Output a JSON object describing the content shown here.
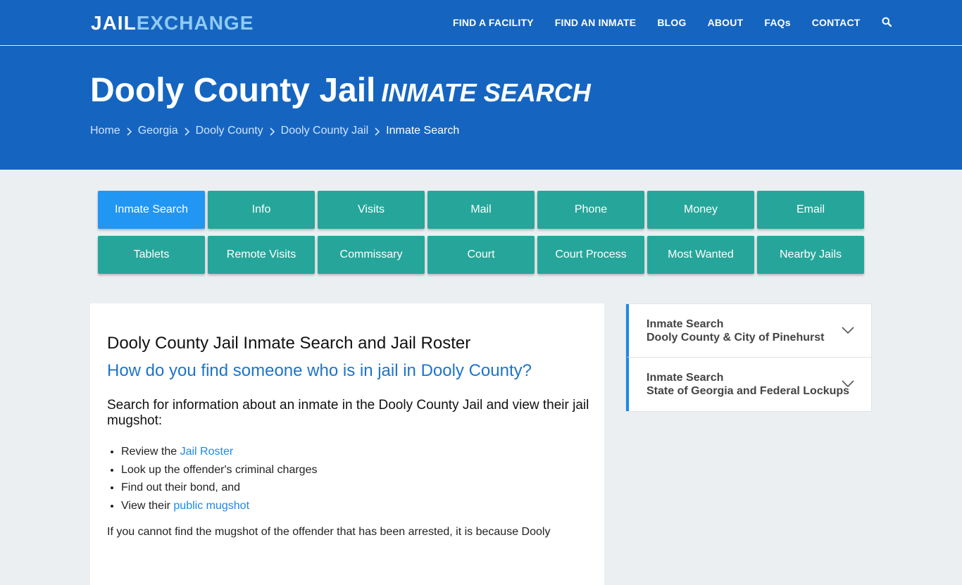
{
  "header": {
    "logo_part1": "JAIL",
    "logo_part2": "EXCHANGE",
    "nav": [
      "FIND A FACILITY",
      "FIND AN INMATE",
      "BLOG",
      "ABOUT",
      "FAQs",
      "CONTACT"
    ],
    "search_icon": "search-icon"
  },
  "hero": {
    "title": "Dooly County Jail",
    "subtitle": "Inmate Search",
    "breadcrumbs": [
      "Home",
      "Georgia",
      "Dooly County",
      "Dooly County Jail"
    ],
    "breadcrumb_current": "Inmate Search"
  },
  "tabs": {
    "row1": [
      "Inmate Search",
      "Info",
      "Visits",
      "Mail",
      "Phone",
      "Money",
      "Email"
    ],
    "row2": [
      "Tablets",
      "Remote Visits",
      "Commissary",
      "Court",
      "Court Process",
      "Most Wanted",
      "Nearby Jails"
    ],
    "active": "Inmate Search",
    "color": "#26a69a",
    "active_color": "#2196f3"
  },
  "main": {
    "heading": "Dooly County Jail Inmate Search and Jail Roster",
    "question": "How do you find someone who is in jail in Dooly County?",
    "intro": "Search for information about an inmate in the Dooly County Jail and view their jail mugshot:",
    "list": {
      "item1_pre": "Review the ",
      "item1_link": "Jail Roster",
      "item2": "Look up the offender's criminal charges",
      "item3": "Find out their bond, and",
      "item4_pre": "View their ",
      "item4_link": "public mugshot"
    },
    "para": "If you cannot find the mugshot of the offender that has been arrested, it is because Dooly"
  },
  "sidebar": {
    "items": [
      {
        "line1": "Inmate Search",
        "line2": "Dooly County & City of Pinehurst"
      },
      {
        "line1": "Inmate Search",
        "line2": "State of Georgia and Federal Lockups"
      }
    ]
  },
  "colors": {
    "brand_blue": "#1565c0",
    "logo_accent": "#90caf9",
    "link": "#1e88e5"
  }
}
